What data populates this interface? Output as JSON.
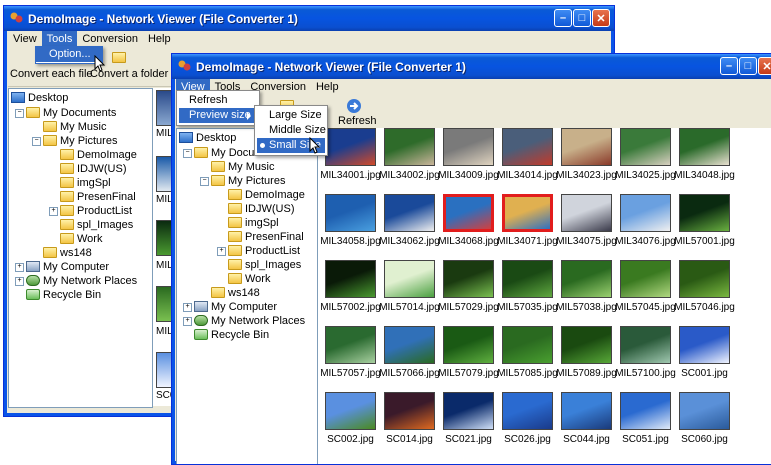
{
  "back_window": {
    "title": "DemoImage - Network Viewer (File Converter 1)",
    "menu": [
      "View",
      "Tools",
      "Conversion",
      "Help"
    ],
    "active_menu": "Tools",
    "tools_menu_items": [
      "Option..."
    ],
    "toolbar_labels": [
      "Convert each file",
      "Convert a folder"
    ],
    "thumb_captions": [
      "MIL3",
      "MIL3",
      "MIL5",
      "MIL5",
      "SC0"
    ]
  },
  "front_window": {
    "title": "DemoImage - Network Viewer (File Converter 1)",
    "menu": [
      "View",
      "Tools",
      "Conversion",
      "Help"
    ],
    "active_menu": "View",
    "view_menu_items": [
      "Refresh",
      "Preview size"
    ],
    "preview_size_items": [
      "Large Size",
      "Middle Size",
      "Small Size"
    ],
    "preview_size_selected": "Small Size",
    "toolbar_refresh": "Refresh"
  },
  "tree": {
    "desktop": "Desktop",
    "my_documents": "My Documents",
    "my_music": "My Music",
    "my_pictures": "My Pictures",
    "folders": [
      "DemoImage",
      "IDJW(US)",
      "imgSpl",
      "PresenFinal",
      "ProductList",
      "spl_Images",
      "Work"
    ],
    "ws148": "ws148",
    "my_computer": "My Computer",
    "my_network_places": "My Network Places",
    "recycle_bin": "Recycle Bin"
  },
  "thumbnails": [
    {
      "name": "MIL34001.jpg",
      "colors": [
        "#1a3d8f",
        "#d14a2a"
      ],
      "selected": false
    },
    {
      "name": "MIL34002.jpg",
      "colors": [
        "#2e6b2a",
        "#c9b59a"
      ],
      "selected": false
    },
    {
      "name": "MIL34009.jpg",
      "colors": [
        "#7a7a7a",
        "#e0d4c0"
      ],
      "selected": false
    },
    {
      "name": "MIL34014.jpg",
      "colors": [
        "#4a5e7a",
        "#c23a2a"
      ],
      "selected": false
    },
    {
      "name": "MIL34023.jpg",
      "colors": [
        "#c8b08a",
        "#8a3a2a"
      ],
      "selected": false
    },
    {
      "name": "MIL34025.jpg",
      "colors": [
        "#3a7a3a",
        "#d8d0c0"
      ],
      "selected": false
    },
    {
      "name": "MIL34048.jpg",
      "colors": [
        "#2a6a2a",
        "#e8e0d0"
      ],
      "selected": false
    },
    {
      "name": "MIL34058.jpg",
      "colors": [
        "#1e5fb0",
        "#4aa0e0"
      ],
      "selected": false
    },
    {
      "name": "MIL34062.jpg",
      "colors": [
        "#1a4a9a",
        "#f0f0f0"
      ],
      "selected": false
    },
    {
      "name": "MIL34068.jpg",
      "colors": [
        "#2a70c0",
        "#d04040"
      ],
      "selected": true
    },
    {
      "name": "MIL34071.jpg",
      "colors": [
        "#e0b050",
        "#3070c0"
      ],
      "selected": true
    },
    {
      "name": "MIL34075.jpg",
      "colors": [
        "#d0d4dc",
        "#3a3a4a"
      ],
      "selected": false
    },
    {
      "name": "MIL34076.jpg",
      "colors": [
        "#6aa0e0",
        "#f0f0f0"
      ],
      "selected": false
    },
    {
      "name": "MIL57001.jpg",
      "colors": [
        "#0a2a10",
        "#6ab040"
      ],
      "selected": false
    },
    {
      "name": "MIL57002.jpg",
      "colors": [
        "#0a1a08",
        "#4a9a30"
      ],
      "selected": false
    },
    {
      "name": "MIL57014.jpg",
      "colors": [
        "#e0f0d0",
        "#4aa040"
      ],
      "selected": false
    },
    {
      "name": "MIL57029.jpg",
      "colors": [
        "#1a3a10",
        "#7ac050"
      ],
      "selected": false
    },
    {
      "name": "MIL57035.jpg",
      "colors": [
        "#1a4a14",
        "#60a840"
      ],
      "selected": false
    },
    {
      "name": "MIL57038.jpg",
      "colors": [
        "#2a6a20",
        "#9ad070"
      ],
      "selected": false
    },
    {
      "name": "MIL57045.jpg",
      "colors": [
        "#3a7a20",
        "#b0d880"
      ],
      "selected": false
    },
    {
      "name": "MIL57046.jpg",
      "colors": [
        "#2a5a14",
        "#7ab840"
      ],
      "selected": false
    },
    {
      "name": "MIL57057.jpg",
      "colors": [
        "#2a6a30",
        "#a8d0a0"
      ],
      "selected": false
    },
    {
      "name": "MIL57066.jpg",
      "colors": [
        "#3070b8",
        "#2a6a20"
      ],
      "selected": false
    },
    {
      "name": "MIL57079.jpg",
      "colors": [
        "#1a5a14",
        "#60b040"
      ],
      "selected": false
    },
    {
      "name": "MIL57085.jpg",
      "colors": [
        "#2a6a20",
        "#4aa030"
      ],
      "selected": false
    },
    {
      "name": "MIL57089.jpg",
      "colors": [
        "#1a4a10",
        "#58a838"
      ],
      "selected": false
    },
    {
      "name": "MIL57100.jpg",
      "colors": [
        "#2a5a3a",
        "#a0c8b0"
      ],
      "selected": false
    },
    {
      "name": "SC001.jpg",
      "colors": [
        "#2a5ac8",
        "#f0f4ff"
      ],
      "selected": false
    },
    {
      "name": "SC002.jpg",
      "colors": [
        "#5a90e0",
        "#4a8a20"
      ],
      "selected": false
    },
    {
      "name": "SC014.jpg",
      "colors": [
        "#3a1a2a",
        "#e06a20"
      ],
      "selected": false
    },
    {
      "name": "SC021.jpg",
      "colors": [
        "#0a2a6a",
        "#d0e0f8"
      ],
      "selected": false
    },
    {
      "name": "SC026.jpg",
      "colors": [
        "#2a6ad0",
        "#1a3a8a"
      ],
      "selected": false
    },
    {
      "name": "SC044.jpg",
      "colors": [
        "#3a80d8",
        "#1a3a7a"
      ],
      "selected": false
    },
    {
      "name": "SC051.jpg",
      "colors": [
        "#2a6ad0",
        "#e0eaf8"
      ],
      "selected": false
    },
    {
      "name": "SC060.jpg",
      "colors": [
        "#5a90d8",
        "#2a5a9a"
      ],
      "selected": false
    }
  ]
}
